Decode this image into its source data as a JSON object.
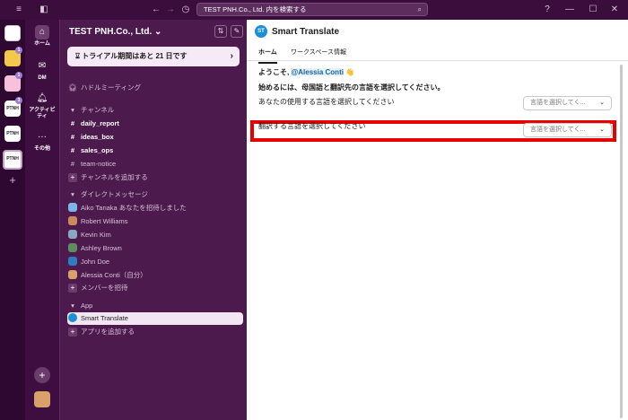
{
  "titlebar": {
    "search_text": "TEST PNH.Co., Ltd. 内を検索する"
  },
  "workspaces": [
    {
      "label": "",
      "color": "#ffffff"
    },
    {
      "label": "",
      "color": "#f2c94c",
      "badge": "1"
    },
    {
      "label": "",
      "color": "#f6c1d9",
      "badge": "1"
    },
    {
      "label": "PTNH",
      "color": "#ffffff",
      "badge": "3"
    },
    {
      "label": "PTNH",
      "color": "#ffffff"
    },
    {
      "label": "PTNH",
      "color": "#ffffff"
    }
  ],
  "nav": {
    "home": "ホーム",
    "dm": "DM",
    "activity": "アクティビティ",
    "more": "その他"
  },
  "sidebar": {
    "workspace_name": "TEST PNH.Co., Ltd.",
    "trial_text": "トライアル期間はあと 21 日です",
    "huddle": "ハドルミーティング",
    "channels_header": "チャンネル",
    "channels": [
      {
        "name": "daily_report",
        "bold": true
      },
      {
        "name": "ideas_box",
        "bold": true
      },
      {
        "name": "sales_ops",
        "bold": true
      },
      {
        "name": "team-notice",
        "bold": false
      }
    ],
    "add_channel": "チャンネルを追加する",
    "dm_header": "ダイレクトメッセージ",
    "dms": [
      {
        "name": "Aiko Tanaka  あなたを招待しました",
        "color": "#7cb5e8"
      },
      {
        "name": "Robert Williams",
        "color": "#c98a5c"
      },
      {
        "name": "Kevin Kim",
        "color": "#8aa7c2"
      },
      {
        "name": "Ashley Brown",
        "color": "#5c8f5f"
      },
      {
        "name": "John Doe",
        "color": "#2f7dbe"
      },
      {
        "name": "Alessia Conti（自分）",
        "color": "#d9a06a"
      }
    ],
    "invite_members": "メンバーを招待",
    "app_header": "App",
    "app_item": "Smart Translate",
    "add_app": "アプリを追加する"
  },
  "main": {
    "app_logo_text": "ST",
    "title": "Smart Translate",
    "tabs": [
      "ホーム",
      "ワークスペース情報"
    ],
    "welcome_prefix": "ようこそ,",
    "welcome_mention": "@Alessia Conti",
    "welcome_emoji": "👋",
    "instruction": "始めるには、母国語と翻訳先の言語を選択してください。",
    "your_language_label": "あなたの使用する言語を選択してください",
    "target_language_label": "翻訳する言語を選択してください",
    "select_placeholder": "言語を選択してく..."
  },
  "colors": {
    "highlight": "#e60000",
    "sidebar_bg": "#4d1a4e",
    "rail_bg": "#2e0830"
  }
}
